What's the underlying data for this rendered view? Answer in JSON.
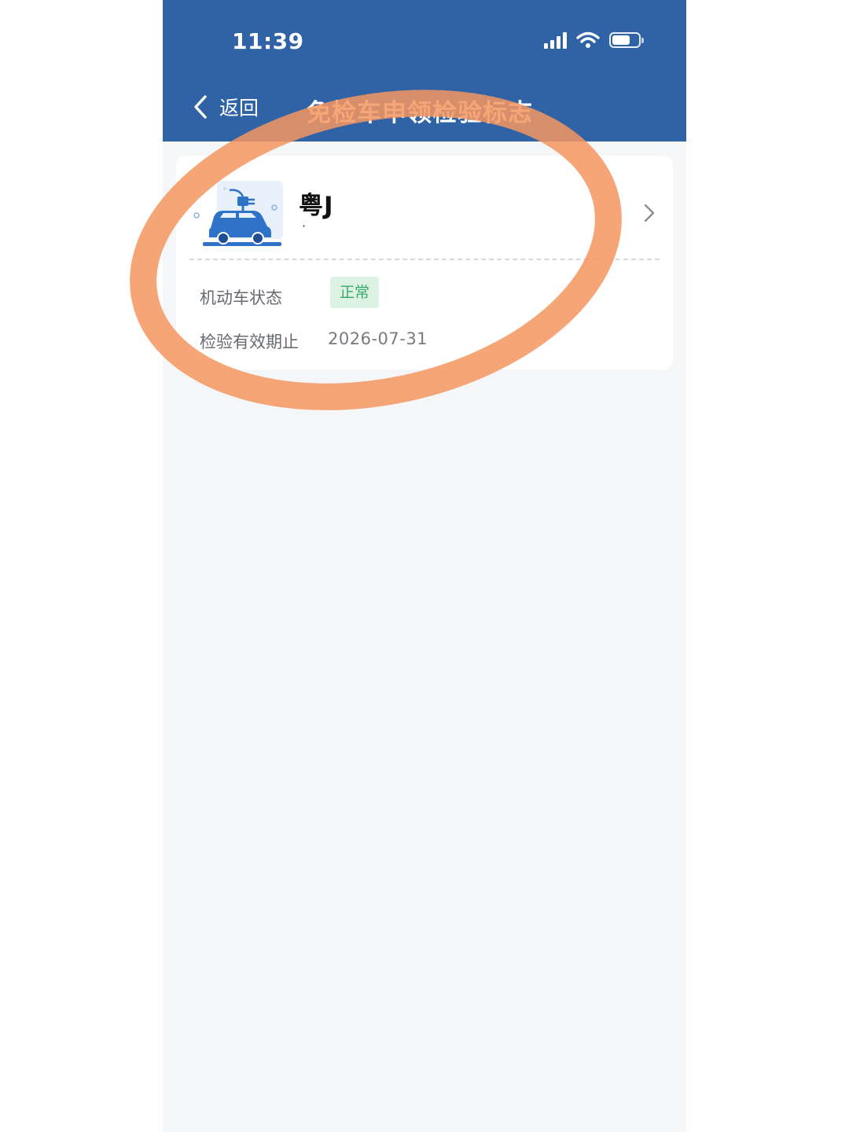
{
  "status_bar": {
    "time": "11:39"
  },
  "nav": {
    "back_label": "返回",
    "title": "免检车申领检验标志"
  },
  "vehicle_card": {
    "plate_visible": "粤J",
    "fields": {
      "status_label": "机动车状态",
      "status_value": "正常",
      "expiry_label": "检验有效期止",
      "expiry_value": "2026-07-31"
    }
  },
  "colors": {
    "header_bg": "#2f63a6",
    "badge_bg": "#dcf2e3",
    "badge_text": "#3aa866",
    "highlight_stroke": "#f4955f"
  },
  "icons": [
    "signal-icon",
    "wifi-icon",
    "battery-icon",
    "back-chevron-icon",
    "electric-car-icon",
    "chevron-right-icon"
  ]
}
